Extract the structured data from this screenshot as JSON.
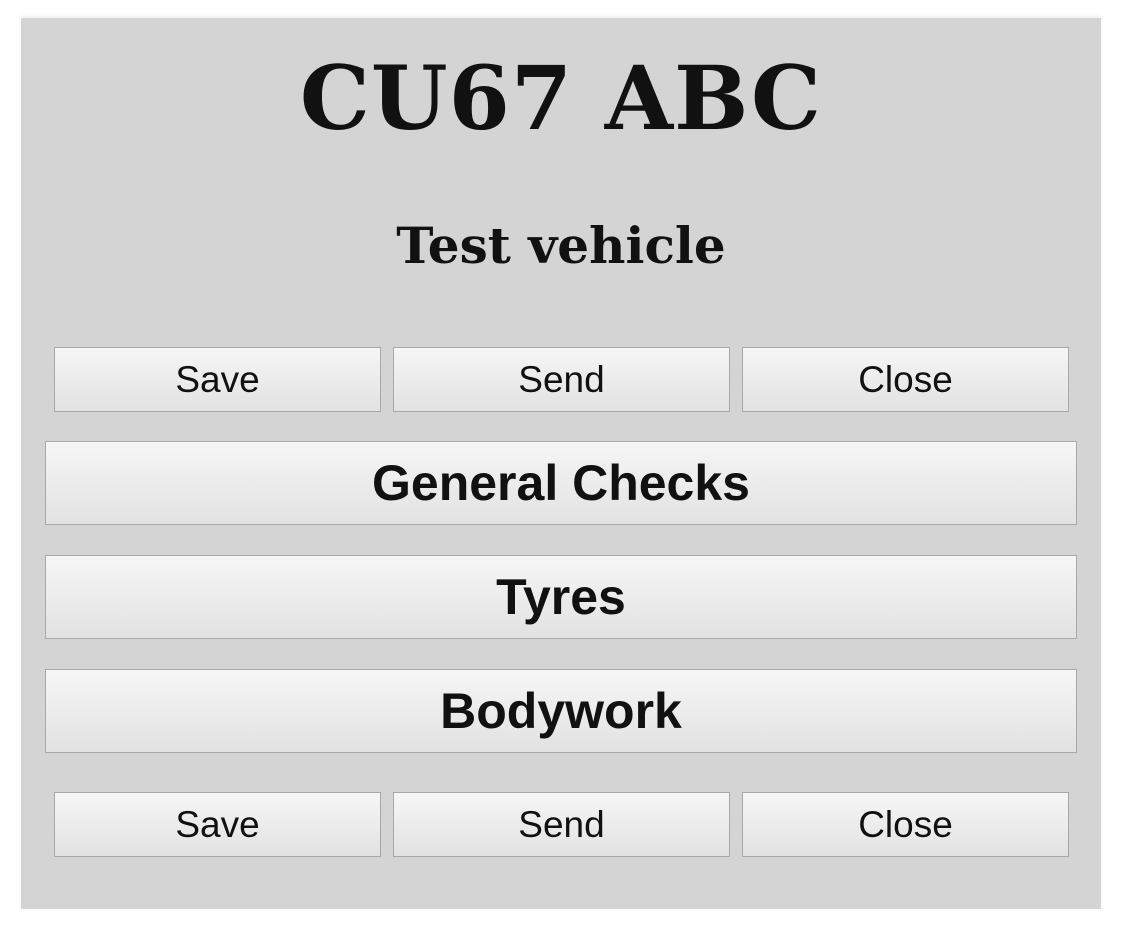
{
  "vehicle": {
    "registration": "CU67 ABC",
    "description": "Test vehicle"
  },
  "actions_top": {
    "save_label": "Save",
    "send_label": "Send",
    "close_label": "Close"
  },
  "sections": [
    {
      "label": "General Checks"
    },
    {
      "label": "Tyres"
    },
    {
      "label": "Bodywork"
    }
  ],
  "actions_bottom": {
    "save_label": "Save",
    "send_label": "Send",
    "close_label": "Close"
  }
}
